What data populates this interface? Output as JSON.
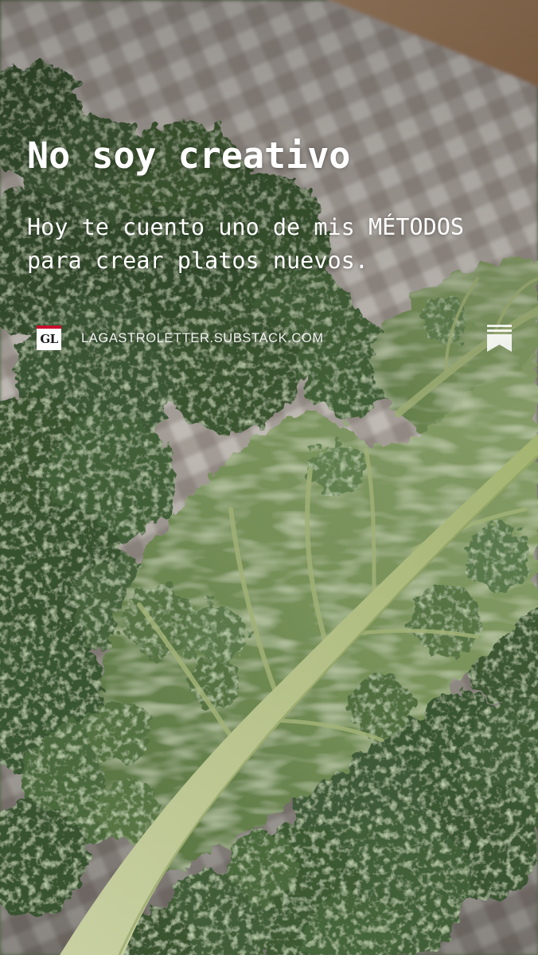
{
  "story_card": {
    "title": "No soy creativo",
    "subtitle": "Hoy te cuento uno de mis MÉTODOS para crear platos nuevos."
  },
  "publication": {
    "logo_text": "GL",
    "url": "LAGASTROLETTER.SUBSTACK.COM"
  },
  "icons": {
    "logo": "publication-logo-icon",
    "bookmark": "bookmark-icon"
  },
  "colors": {
    "text": "#ffffff",
    "logo_background": "#ffffff",
    "logo_accent": "#c8102e"
  }
}
